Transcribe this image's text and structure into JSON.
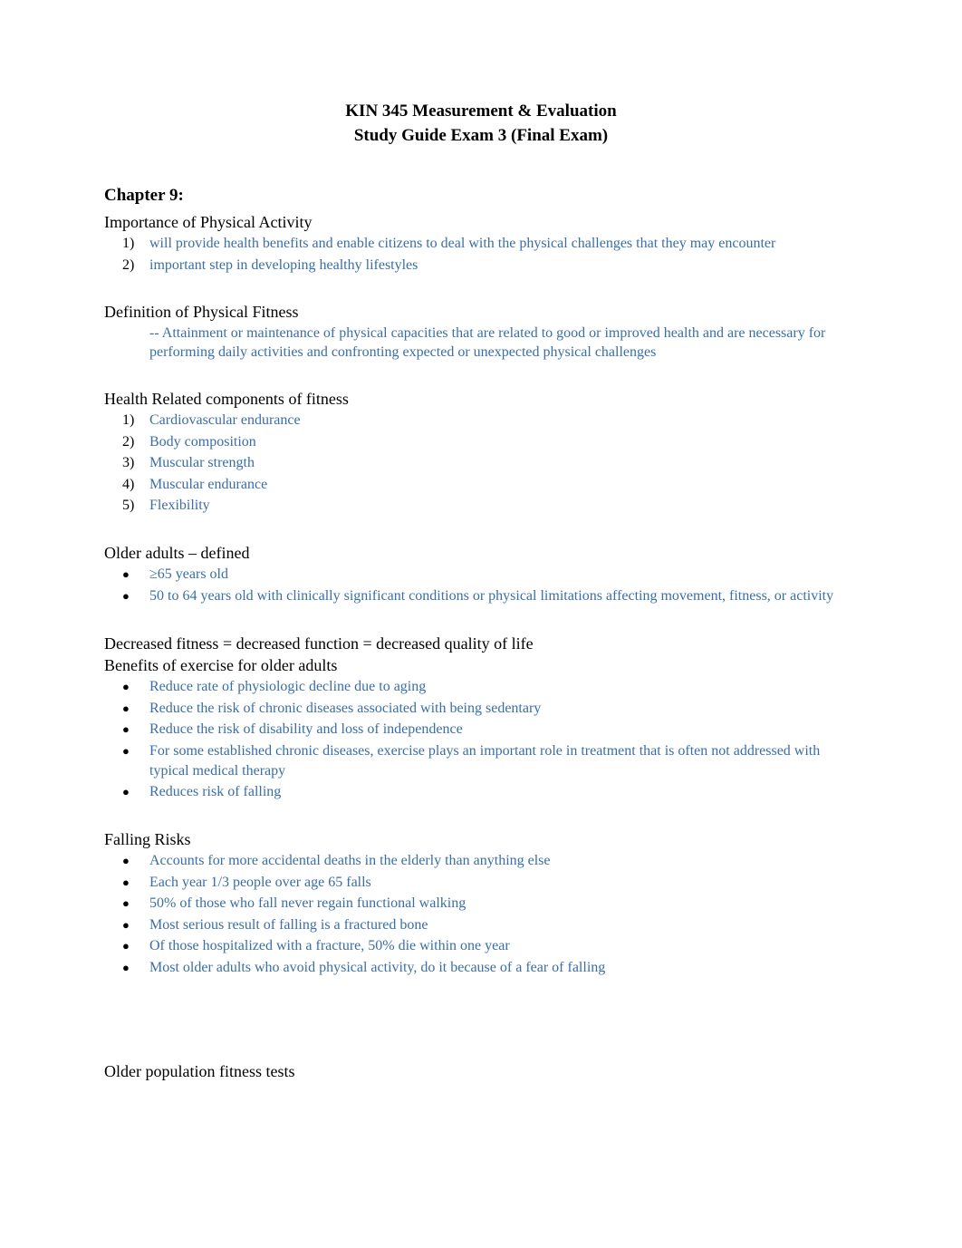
{
  "title": {
    "line1": "KIN 345 Measurement & Evaluation",
    "line2": "Study Guide Exam 3 (Final Exam)"
  },
  "chapter_heading": "Chapter 9:",
  "sections": {
    "importance": {
      "heading": "Importance of Physical Activity",
      "items": [
        "will provide health benefits and enable citizens to deal with the physical challenges that they may encounter",
        "important step in developing healthy lifestyles"
      ]
    },
    "definition": {
      "heading": "Definition of Physical Fitness",
      "text": "-- Attainment or maintenance of physical capacities that are related to good or improved health and are necessary for performing daily activities and confronting expected or unexpected physical challenges"
    },
    "components": {
      "heading": "Health Related components of fitness",
      "items": [
        "Cardiovascular endurance",
        "Body composition",
        "Muscular strength",
        "Muscular endurance",
        "Flexibility"
      ]
    },
    "older_adults": {
      "heading": "Older adults – defined",
      "items": [
        "≥65 years old",
        "50 to 64 years old with clinically significant conditions or physical limitations affecting movement, fitness, or activity"
      ]
    },
    "benefits": {
      "heading1": "Decreased fitness = decreased function = decreased quality of life",
      "heading2": "Benefits of exercise for older adults",
      "items": [
        "Reduce rate of physiologic decline due to aging",
        "Reduce the risk of chronic diseases associated with being sedentary",
        "Reduce the risk of disability and loss of independence",
        "For some established chronic diseases, exercise plays an important role in treatment that is often not addressed with typical medical therapy",
        "Reduces risk of falling"
      ]
    },
    "falling_risks": {
      "heading": "Falling Risks",
      "items": [
        "Accounts for more accidental deaths in the elderly than anything else",
        "Each year 1/3 people over age 65 falls",
        "50% of those who fall never regain functional walking",
        "Most serious result of falling is a fractured bone",
        "Of those hospitalized with a fracture, 50% die within one year",
        "Most older adults who avoid physical activity, do it because of a fear of falling"
      ]
    },
    "older_tests": {
      "heading": "Older population fitness tests"
    }
  }
}
